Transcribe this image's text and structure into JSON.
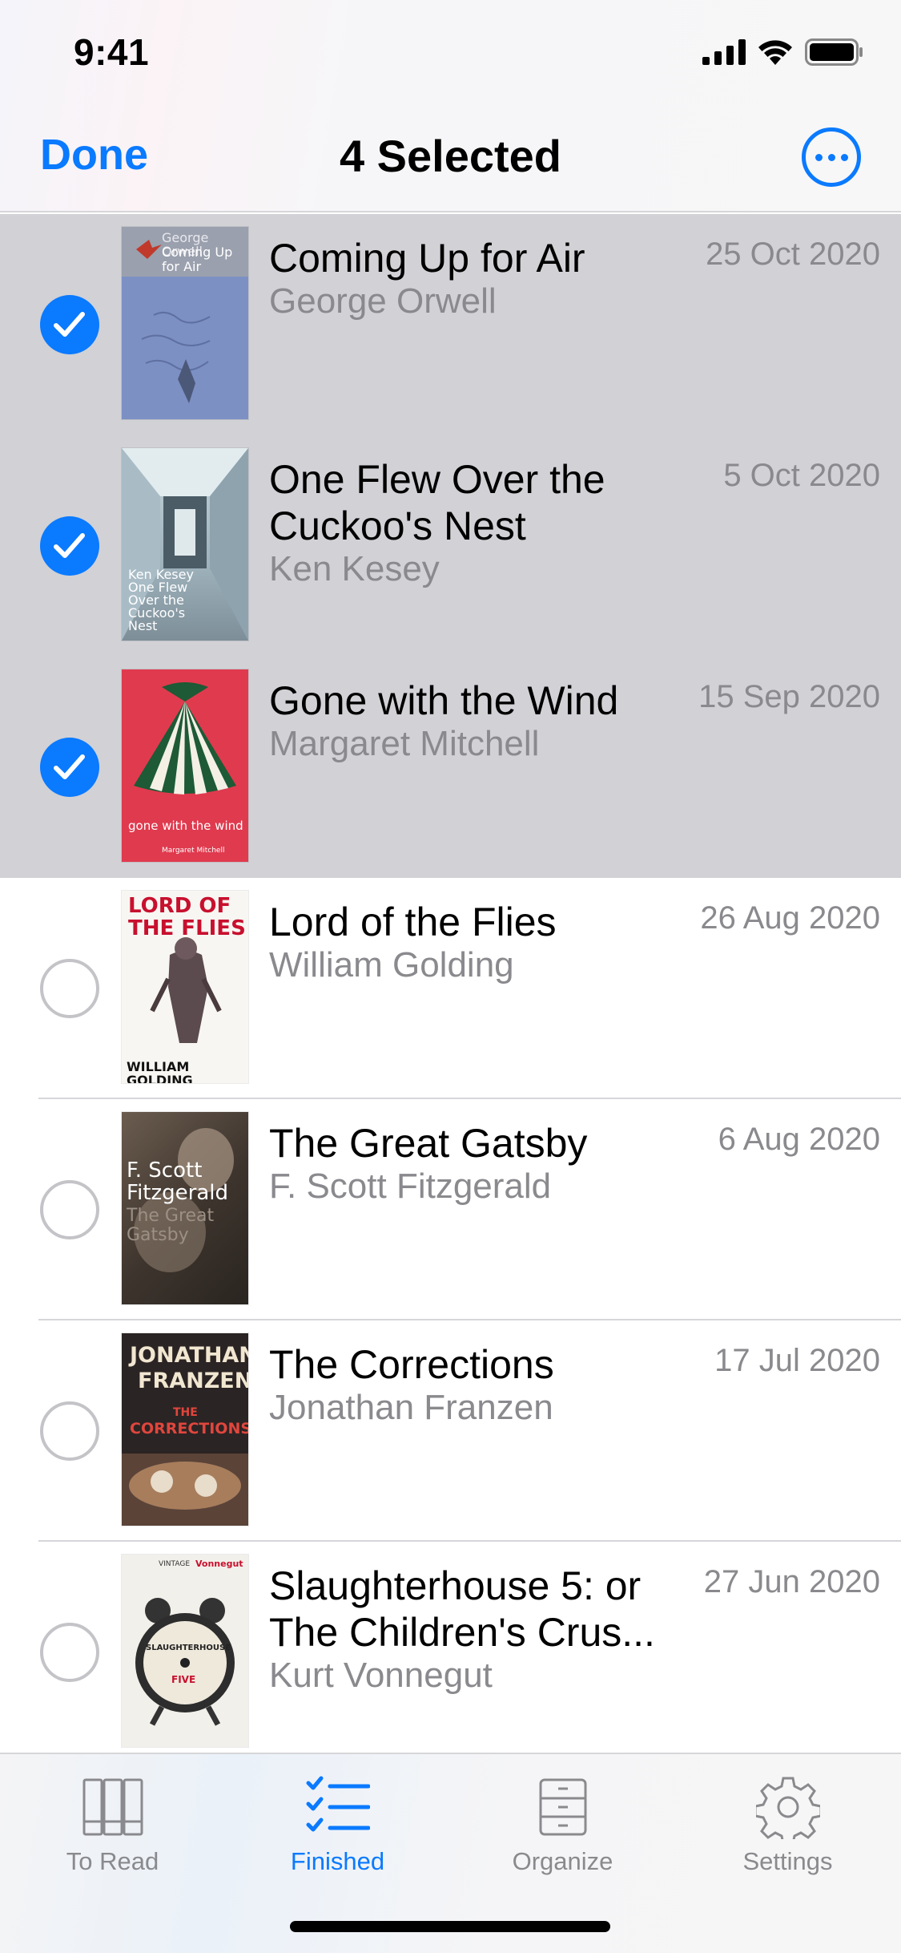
{
  "status": {
    "time": "9:41"
  },
  "nav": {
    "done_label": "Done",
    "title": "4 Selected",
    "more_icon": "ellipsis-circle-icon"
  },
  "books": [
    {
      "title": "Coming Up for Air",
      "author": "George Orwell",
      "date": "25 Oct 2020",
      "selected": true,
      "cover_text": [
        "George Orwell",
        "Coming Up",
        "for Air"
      ]
    },
    {
      "title": "One Flew Over the Cuckoo's Nest",
      "author": "Ken Kesey",
      "date": "5 Oct 2020",
      "selected": true,
      "cover_text": [
        "Ken Kesey",
        "One Flew",
        "Over the",
        "Cuckoo's",
        "Nest"
      ]
    },
    {
      "title": "Gone with the Wind",
      "author": "Margaret Mitchell",
      "date": "15 Sep 2020",
      "selected": true,
      "cover_text": [
        "gone with the wind",
        "Margaret Mitchell"
      ]
    },
    {
      "title": "Lord of the Flies",
      "author": "William Golding",
      "date": "26 Aug 2020",
      "selected": false,
      "cover_text": [
        "LORD OF",
        "THE FLIES",
        "WILLIAM GOLDING"
      ]
    },
    {
      "title": "The Great Gatsby",
      "author": "F. Scott Fitzgerald",
      "date": "6 Aug 2020",
      "selected": false,
      "cover_text": [
        "F. Scott",
        "Fitzgerald",
        "The Great",
        "Gatsby"
      ]
    },
    {
      "title": "The Corrections",
      "author": "Jonathan Franzen",
      "date": "17 Jul 2020",
      "selected": false,
      "cover_text": [
        "JONATHAN",
        "FRANZEN",
        "THE",
        "CORRECTIONS"
      ]
    },
    {
      "title": "Slaughterhouse 5: or The Children's Crus...",
      "author": "Kurt Vonnegut",
      "date": "27 Jun 2020",
      "selected": false,
      "cover_text": [
        "VINTAGE",
        "Vonnegut",
        "SLAUGHTERHOUSE",
        "FIVE"
      ]
    }
  ],
  "tabs": [
    {
      "label": "To Read",
      "icon": "books-icon",
      "active": false
    },
    {
      "label": "Finished",
      "icon": "checklist-icon",
      "active": true
    },
    {
      "label": "Organize",
      "icon": "cabinet-icon",
      "active": false
    },
    {
      "label": "Settings",
      "icon": "gear-icon",
      "active": false
    }
  ],
  "colors": {
    "accent": "#0a7aff",
    "selected_row": "#d1d1d6",
    "secondary_text": "#8a8a8e"
  }
}
